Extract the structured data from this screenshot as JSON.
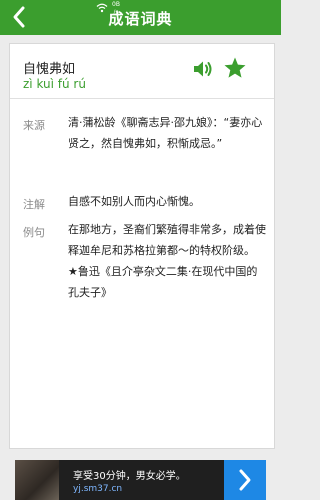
{
  "header": {
    "title": "成语词典",
    "net_speed_value": "0B",
    "net_speed_unit": "/s"
  },
  "entry": {
    "word": "自愧弗如",
    "pinyin": "zì kuì fú rú",
    "sections": [
      {
        "label": "来源",
        "text": "清·蒲松龄《聊斋志异·邵九娘》：“妻亦心贤之，然自愧弗如，积惭成忌。”"
      },
      {
        "label": "注解",
        "text": "自感不如别人而内心惭愧。"
      },
      {
        "label": "例句",
        "text": "在那地方，圣裔们繁殖得非常多，成着使释迦牟尼和苏格拉第都～的特权阶级。 ★鲁迅《且介亭杂文二集·在现代中国的孔夫子》"
      }
    ]
  },
  "ad": {
    "title": "享受30分钟，男女必学。",
    "url": "yj.sm37.cn"
  },
  "icons": {
    "back": "back-arrow-icon",
    "speaker": "speaker-icon",
    "star": "star-icon",
    "ad_arrow": "chevron-right-icon",
    "wifi": "wifi-icon"
  },
  "colors": {
    "brand_green": "#3b9e2e",
    "ad_blue": "#1e88e5"
  }
}
